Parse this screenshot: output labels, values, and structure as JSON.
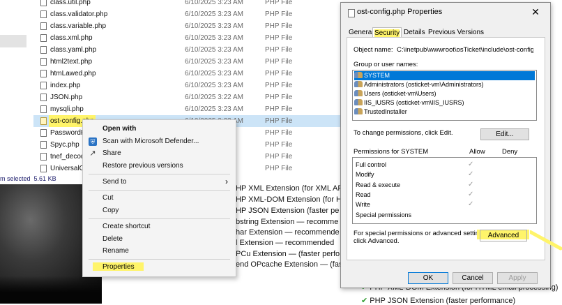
{
  "status": {
    "selection": "m selected",
    "size": "5.61 KB"
  },
  "files": [
    {
      "name": "class.util.php",
      "date": "6/10/2025 3:23 AM",
      "type": "PHP File"
    },
    {
      "name": "class.validator.php",
      "date": "6/10/2025 3:23 AM",
      "type": "PHP File"
    },
    {
      "name": "class.variable.php",
      "date": "6/10/2025 3:23 AM",
      "type": "PHP File"
    },
    {
      "name": "class.xml.php",
      "date": "6/10/2025 3:23 AM",
      "type": "PHP File"
    },
    {
      "name": "class.yaml.php",
      "date": "6/10/2025 3:23 AM",
      "type": "PHP File"
    },
    {
      "name": "html2text.php",
      "date": "6/10/2025 3:23 AM",
      "type": "PHP File"
    },
    {
      "name": "htmLawed.php",
      "date": "6/10/2025 3:23 AM",
      "type": "PHP File"
    },
    {
      "name": "index.php",
      "date": "6/10/2025 3:23 AM",
      "type": "PHP File"
    },
    {
      "name": "JSON.php",
      "date": "6/10/2025 3:22 AM",
      "type": "PHP File"
    },
    {
      "name": "mysqli.php",
      "date": "6/10/2025 3:23 AM",
      "type": "PHP File"
    },
    {
      "name": "ost-config.php",
      "date": "6/10/2025 3:23 AM",
      "type": "PHP File"
    },
    {
      "name": "PasswordH",
      "date": "",
      "type": "PHP File"
    },
    {
      "name": "Spyc.php",
      "date": "",
      "type": "PHP File"
    },
    {
      "name": "tnef_decod",
      "date": "",
      "type": "PHP File"
    },
    {
      "name": "UniversalCl",
      "date": "",
      "type": "PHP File"
    }
  ],
  "context_menu": {
    "open_with": "Open with",
    "scan": "Scan with Microsoft Defender...",
    "share": "Share",
    "restore": "Restore previous versions",
    "send_to": "Send to",
    "cut": "Cut",
    "copy": "Copy",
    "create_shortcut": "Create shortcut",
    "delete": "Delete",
    "rename": "Rename",
    "properties": "Properties"
  },
  "background_lines": [
    "HP XML Extension (for XML AF",
    "HP XML-DOM Extension (for H",
    "HP JSON Extension (faster pe",
    "bstring Extension — recomme",
    "har Extension — recommende",
    "l Extension — recommended",
    "PCu Extension — (faster perfo",
    "end OPcache Extension — (fas"
  ],
  "below_dialog": {
    "line1": "PHP XML-DOM Extension (for HTML email processing)",
    "line2": "PHP JSON Extension (faster performance)"
  },
  "dialog": {
    "title": "ost-config.php Properties",
    "close": "✕",
    "tabs": {
      "general": "General",
      "security": "Security",
      "details": "Details",
      "previous": "Previous Versions"
    },
    "object_label": "Object name:",
    "object_value": "C:\\inetpub\\wwwroot\\osTicket\\include\\ost-config.p",
    "group_label": "Group or user names:",
    "groups": [
      "SYSTEM",
      "Administrators (osticket-vm\\Administrators)",
      "Users (osticket-vm\\Users)",
      "IIS_IUSRS (osticket-vm\\IIS_IUSRS)",
      "TrustedInstaller"
    ],
    "change_text": "To change permissions, click Edit.",
    "edit_button": "Edit...",
    "perm_label": "Permissions for SYSTEM",
    "allow_label": "Allow",
    "deny_label": "Deny",
    "permissions": [
      "Full control",
      "Modify",
      "Read & execute",
      "Read",
      "Write",
      "Special permissions"
    ],
    "check_glyph": "✓",
    "special_text_1": "For special permissions or advanced settings,",
    "special_text_2": "click Advanced.",
    "advanced_button": "Advanced",
    "ok": "OK",
    "cancel": "Cancel",
    "apply": "Apply"
  },
  "colors": {
    "highlight": "#fff46a",
    "selection": "#0078d7",
    "row_selected": "#cce4f7"
  }
}
